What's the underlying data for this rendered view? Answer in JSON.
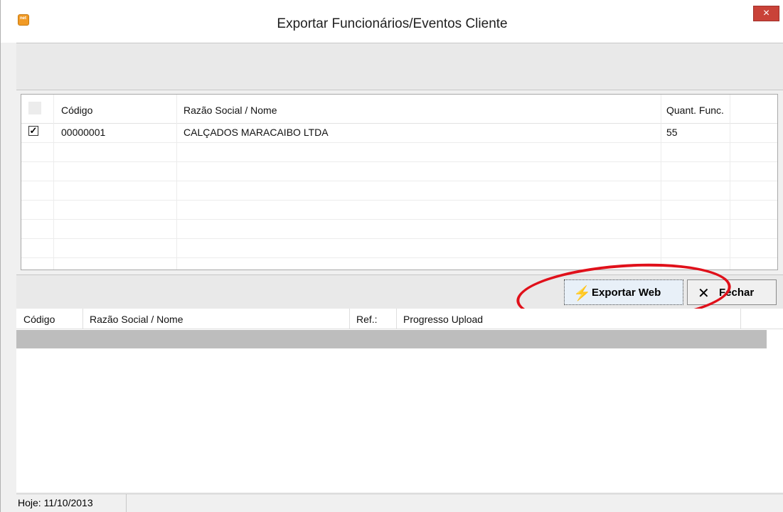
{
  "window": {
    "title": "Exportar Funcionários/Eventos Cliente",
    "close_label": "×",
    "app_icon_label": "net"
  },
  "client_grid": {
    "columns": [
      "Código",
      "Razão Social / Nome",
      "Quant. Func."
    ],
    "rows": [
      {
        "checked": true,
        "codigo": "00000001",
        "razao": "CALÇADOS MARACAIBO LTDA",
        "quant": "55"
      }
    ]
  },
  "toolbar": {
    "export_label": "Exportar Web",
    "export_icon": "lightning-icon",
    "close_label": "Fechar",
    "close_icon": "x-icon"
  },
  "upload_grid": {
    "columns": [
      "Código",
      "Razão Social / Nome",
      "Ref.:",
      "Progresso Upload"
    ]
  },
  "status": {
    "today": "Hoje: 11/10/2013"
  },
  "colors": {
    "annotation": "#e0101a",
    "close_button": "#c94238",
    "progress": "#bdbdbd"
  }
}
